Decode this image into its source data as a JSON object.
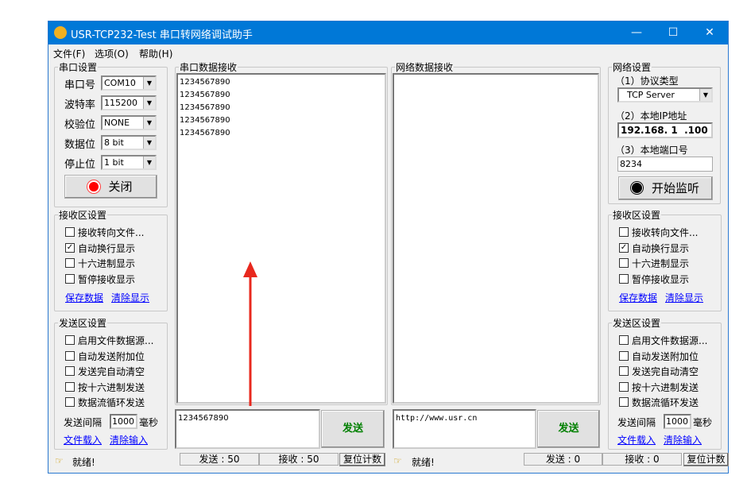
{
  "window": {
    "title": "USR-TCP232-Test 串口转网络调试助手"
  },
  "menu": [
    "文件(F)",
    "选项(O)",
    "帮助(H)"
  ],
  "serial_settings": {
    "title": "串口设置",
    "rows": [
      {
        "label": "串口号",
        "value": "COM10"
      },
      {
        "label": "波特率",
        "value": "115200"
      },
      {
        "label": "校验位",
        "value": "NONE"
      },
      {
        "label": "数据位",
        "value": "8 bit"
      },
      {
        "label": "停止位",
        "value": "1 bit"
      }
    ],
    "button": "关闭"
  },
  "network_settings": {
    "title": "网络设置",
    "protocol_label": "（1）协议类型",
    "protocol": "TCP Server",
    "ip_label": "（2）本地IP地址",
    "ip": "192.168. 1  .100",
    "port_label": "（3）本地端口号",
    "port": "8234",
    "button": "开始监听"
  },
  "left_recv": {
    "title": "接收区设置",
    "options": [
      {
        "label": "接收转向文件...",
        "checked": false
      },
      {
        "label": "自动换行显示",
        "checked": true
      },
      {
        "label": "十六进制显示",
        "checked": false
      },
      {
        "label": "暂停接收显示",
        "checked": false
      }
    ],
    "links": [
      "保存数据",
      "清除显示"
    ]
  },
  "left_send": {
    "title": "发送区设置",
    "options": [
      {
        "label": "启用文件数据源...",
        "checked": false
      },
      {
        "label": "自动发送附加位",
        "checked": false
      },
      {
        "label": "发送完自动清空",
        "checked": false
      },
      {
        "label": "按十六进制发送",
        "checked": false
      },
      {
        "label": "数据流循环发送",
        "checked": false
      }
    ],
    "interval_label": "发送间隔",
    "interval": "1000",
    "interval_unit": "毫秒",
    "links": [
      "文件载入",
      "清除输入"
    ]
  },
  "right_recv": {
    "title": "接收区设置",
    "options": [
      {
        "label": "接收转向文件...",
        "checked": false
      },
      {
        "label": "自动换行显示",
        "checked": true
      },
      {
        "label": "十六进制显示",
        "checked": false
      },
      {
        "label": "暂停接收显示",
        "checked": false
      }
    ],
    "links": [
      "保存数据",
      "清除显示"
    ]
  },
  "right_send": {
    "title": "发送区设置",
    "options": [
      {
        "label": "启用文件数据源...",
        "checked": false
      },
      {
        "label": "自动发送附加位",
        "checked": false
      },
      {
        "label": "发送完自动清空",
        "checked": false
      },
      {
        "label": "按十六进制发送",
        "checked": false
      },
      {
        "label": "数据流循环发送",
        "checked": false
      }
    ],
    "interval_label": "发送间隔",
    "interval": "1000",
    "interval_unit": "毫秒",
    "links": [
      "文件载入",
      "清除输入"
    ]
  },
  "serial_recv": {
    "title": "串口数据接收",
    "lines": [
      "1234567890",
      "1234567890",
      "1234567890",
      "1234567890",
      "1234567890"
    ]
  },
  "net_recv": {
    "title": "网络数据接收"
  },
  "serial_send": {
    "text": "1234567890",
    "button": "发送"
  },
  "net_send": {
    "text": "http://www.usr.cn",
    "button": "发送"
  },
  "status_left": {
    "ready": "就绪!",
    "sent": "发送 : 50",
    "recv": "接收 : 50",
    "reset": "复位计数"
  },
  "status_right": {
    "ready": "就绪!",
    "sent": "发送 : 0",
    "recv": "接收 : 0",
    "reset": "复位计数"
  },
  "colors": {
    "titlebar": "#0078d7",
    "arrow": "#e8281e",
    "send_text": "#008000"
  }
}
